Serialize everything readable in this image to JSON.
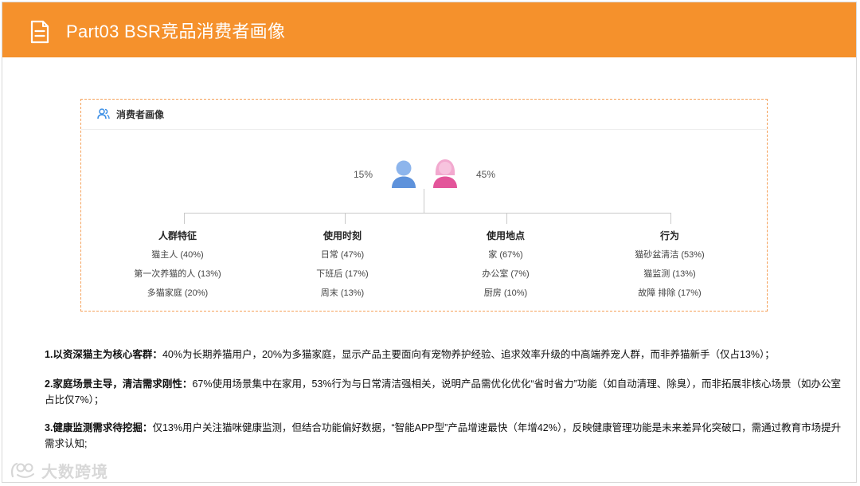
{
  "header": {
    "title": "Part03 BSR竞品消费者画像",
    "icon": "document-icon",
    "background_color": "#f5912c"
  },
  "panel": {
    "title": "消费者画像",
    "icon": "people-icon",
    "border_color": "#f5a15a",
    "gender": {
      "male_pct": "15%",
      "female_pct": "45%",
      "male_color": "#6e9fe0",
      "female_color": "#e3559a"
    },
    "columns": [
      {
        "title": "人群特征",
        "items": [
          "猫主人 (40%)",
          "第一次养猫的人 (13%)",
          "多猫家庭 (20%)"
        ]
      },
      {
        "title": "使用时刻",
        "items": [
          "日常 (47%)",
          "下班后 (17%)",
          "周末 (13%)"
        ]
      },
      {
        "title": "使用地点",
        "items": [
          "家 (67%)",
          "办公室 (7%)",
          "厨房 (10%)"
        ]
      },
      {
        "title": "行为",
        "items": [
          "猫砂盆清洁 (53%)",
          "猫监测 (13%)",
          "故障 排除 (17%)"
        ]
      }
    ]
  },
  "insights": [
    {
      "heading": "1.以资深猫主为核心客群：",
      "body": "40%为长期养猫用户，20%为多猫家庭，显示产品主要面向有宠物养护经验、追求效率升级的中高端养宠人群，而非养猫新手（仅占13%）；"
    },
    {
      "heading": "2.家庭场景主导，清洁需求刚性：",
      "body": "67%使用场景集中在家用，53%行为与日常清洁强相关，说明产品需优化优化“省时省力”功能（如自动清理、除臭），而非拓展非核心场景（如办公室占比仅7%）；"
    },
    {
      "heading": "3.健康监测需求待挖掘：",
      "body": "仅13%用户关注猫咪健康监测，但结合功能偏好数据，“智能APP型”产品增速最快（年增42%），反映健康管理功能是未来差异化突破口，需通过教育市场提升需求认知;"
    }
  ],
  "watermark": {
    "text": "大数跨境",
    "icon": "brand-logo-icon"
  }
}
